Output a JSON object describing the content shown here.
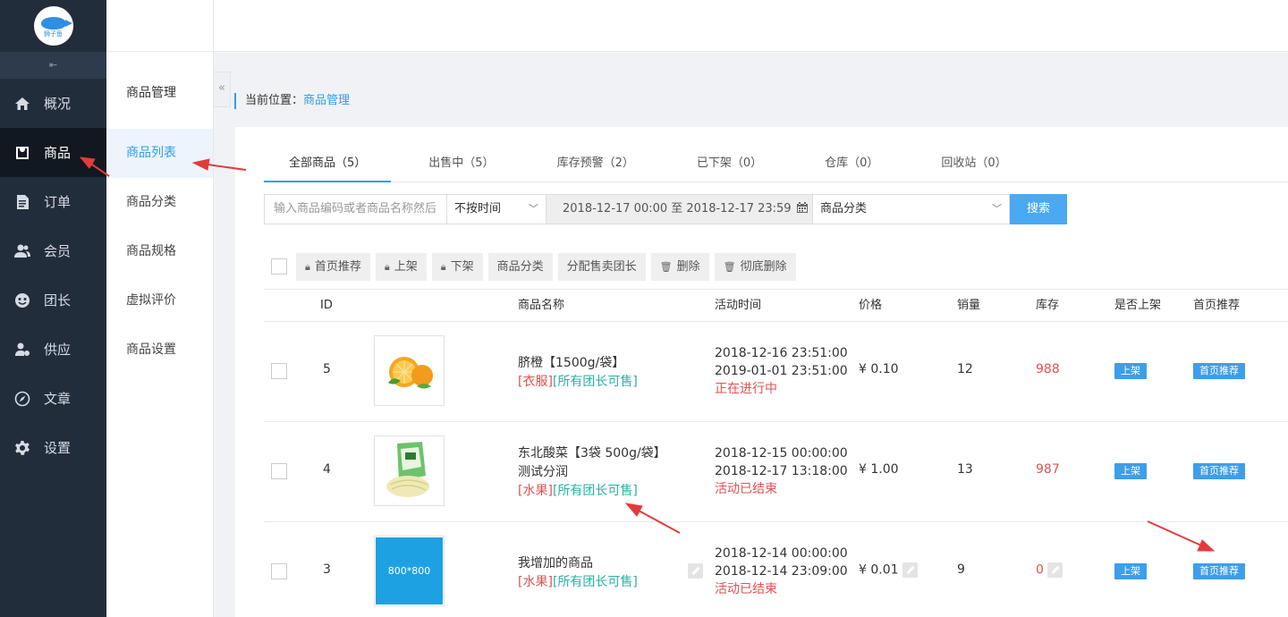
{
  "logo": {
    "text": "狮子鱼"
  },
  "nav": {
    "collapse_icon": "⇤",
    "items": [
      {
        "label": "概况",
        "icon": "home-icon"
      },
      {
        "label": "商品",
        "icon": "bag-icon",
        "active": true
      },
      {
        "label": "订单",
        "icon": "document-icon"
      },
      {
        "label": "会员",
        "icon": "users-icon"
      },
      {
        "label": "团长",
        "icon": "leader-icon"
      },
      {
        "label": "供应",
        "icon": "supplier-icon"
      },
      {
        "label": "文章",
        "icon": "compass-icon"
      },
      {
        "label": "设置",
        "icon": "gear-icon"
      }
    ]
  },
  "subnav": {
    "title": "商品管理",
    "toggle": "«",
    "items": [
      "商品列表",
      "商品分类",
      "商品规格",
      "虚拟评价",
      "商品设置"
    ]
  },
  "breadcrumb": {
    "prefix": "当前位置：",
    "current": "商品管理"
  },
  "tabs": [
    "全部商品（5）",
    "出售中（5）",
    "库存预警（2）",
    "已下架（0）",
    "仓库（0）",
    "回收站（0）"
  ],
  "filters": {
    "search_placeholder": "输入商品编码或者商品名称然后",
    "time_select": "不按时间",
    "date_range": "2018-12-17 00:00 至 2018-12-17 23:59",
    "category_select": "商品分类",
    "search_button": "搜索"
  },
  "actions": [
    "首页推荐",
    "上架",
    "下架",
    "商品分类",
    "分配售卖团长",
    "删除",
    "彻底删除"
  ],
  "table": {
    "headers": [
      "ID",
      "商品名称",
      "活动时间",
      "价格",
      "销量",
      "库存",
      "是否上架",
      "首页推荐"
    ],
    "rows": [
      {
        "id": "5",
        "name": "脐橙【1500g/袋】",
        "name2": "",
        "tag_cat": "[衣服]",
        "tag_all": "[所有团长可售]",
        "start": "2018-12-16 23:51:00",
        "end": "2019-01-01 23:51:00",
        "status": "正在进行中",
        "price": "¥ 0.10",
        "sales": "12",
        "stock": "988",
        "onsale": "上架",
        "recommend": "首页推荐",
        "thumb": "orange"
      },
      {
        "id": "4",
        "name": "东北酸菜【3袋 500g/袋】",
        "name2": "测试分润",
        "tag_cat": "[水果]",
        "tag_all": "[所有团长可售]",
        "start": "2018-12-15 00:00:00",
        "end": "2018-12-17 13:18:00",
        "status": "活动已结束",
        "price": "¥ 1.00",
        "sales": "13",
        "stock": "987",
        "onsale": "上架",
        "recommend": "首页推荐",
        "thumb": "cabbage"
      },
      {
        "id": "3",
        "name": "我增加的商品",
        "name2": "",
        "tag_cat": "[水果]",
        "tag_all": "[所有团长可售]",
        "start": "2018-12-14 00:00:00",
        "end": "2018-12-14 23:09:00",
        "status": "活动已结束",
        "price": "¥ 0.01",
        "sales": "9",
        "stock": "0",
        "onsale": "上架",
        "recommend": "首页推荐",
        "thumb": "placeholder",
        "thumb_text": "800*800"
      }
    ]
  },
  "colors": {
    "accent": "#2f9ee8",
    "nav_bg": "#222d3c",
    "button_blue": "#4aa9f0",
    "badge": "#3d9eea",
    "red": "#e05252",
    "green": "#2bb0a0",
    "arrow": "#e23b3b"
  }
}
